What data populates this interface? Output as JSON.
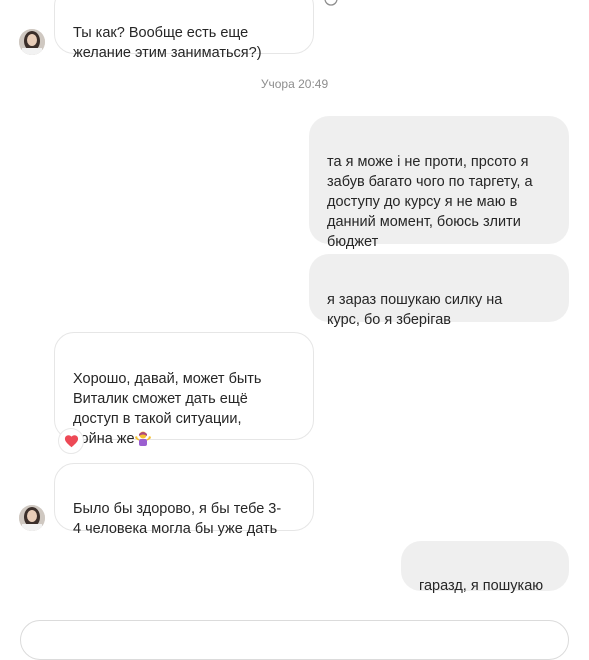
{
  "thread": {
    "timestamp": "Учора 20:49",
    "messages": [
      {
        "direction": "incoming",
        "text": "Ты как? Вообще есть еще\nжелание этим заниматься?)"
      },
      {
        "direction": "outgoing",
        "text": "та я може і не проти, прсото я\nзабув багато чого по таргету, а\nдоступу до курсу я не маю в\nданний момент, боюсь злити\nбюджет"
      },
      {
        "direction": "outgoing",
        "text": "я зараз пошукаю силку на\nкурс, бо я зберігав"
      },
      {
        "direction": "incoming",
        "text": "Хорошо, давай, может быть\nВиталик сможет дать ещё\nдоступ в такой ситуации,\nвойна же",
        "emoji": "person-shrugging-emoji",
        "reaction": "heart-reaction-icon"
      },
      {
        "direction": "incoming",
        "text": "Было бы здорово, я бы тебе 3-\n4 человека могла бы уже дать"
      },
      {
        "direction": "outgoing",
        "text": "гаразд, я пошукаю"
      }
    ]
  },
  "colors": {
    "outgoing_bubble": "#efefef",
    "incoming_border": "#e6e6e6",
    "timestamp_text": "#8e8e8e",
    "reaction_heart": "#ed4956"
  }
}
